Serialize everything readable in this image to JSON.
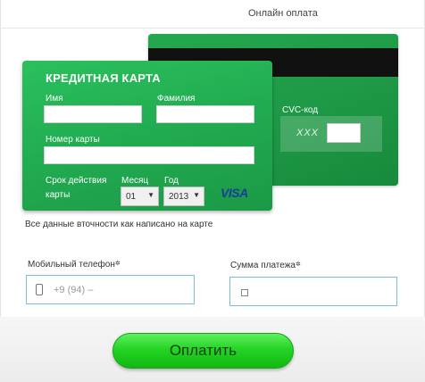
{
  "header": {
    "title": "Онлайн оплата"
  },
  "card_back": {
    "cvc_label": "CVC-код",
    "cvc_placeholder_text": "XXX",
    "cvc_value": ""
  },
  "card_front": {
    "title": "КРЕДИТНАЯ КАРТА",
    "first_name_label": "Имя",
    "last_name_label": "Фамилия",
    "card_number_label": "Номер карты",
    "expiry_label_line1": "Срок действия",
    "expiry_label_line2": "карты",
    "month_label": "Месяц",
    "year_label": "Год",
    "month_value": "01",
    "year_value": "2013",
    "brand": "VISA",
    "first_name_value": "",
    "last_name_value": "",
    "card_number_value": ""
  },
  "note": "Все данные вточности как написано на карте",
  "phone": {
    "label": "Мобильный телефон",
    "placeholder": "+9 (94) –"
  },
  "amount": {
    "label": "Сумма платежа"
  },
  "pay_button": {
    "label": "Оплатить"
  }
}
